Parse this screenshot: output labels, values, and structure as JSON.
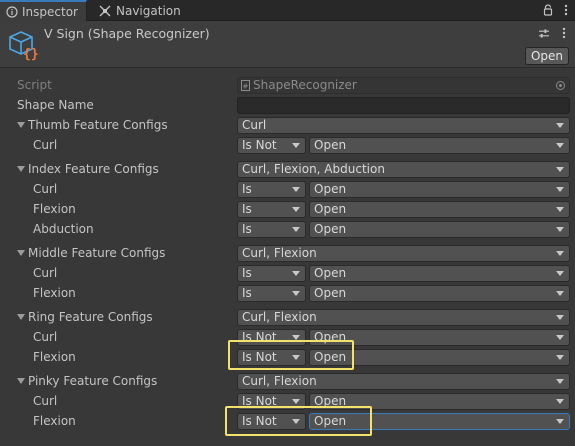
{
  "tabs": {
    "inspector": "Inspector",
    "navigation": "Navigation"
  },
  "header": {
    "title": "V Sign (Shape Recognizer)",
    "open_button": "Open"
  },
  "script_row": {
    "label": "Script",
    "value": "ShapeRecognizer"
  },
  "shape_name": {
    "label": "Shape Name",
    "value": ""
  },
  "groups": [
    {
      "label": "Thumb Feature Configs",
      "mask": "Curl",
      "rows": [
        {
          "feature": "Curl",
          "mode": "Is Not",
          "state": "Open"
        }
      ]
    },
    {
      "label": "Index Feature Configs",
      "mask": "Curl, Flexion, Abduction",
      "rows": [
        {
          "feature": "Curl",
          "mode": "Is",
          "state": "Open"
        },
        {
          "feature": "Flexion",
          "mode": "Is",
          "state": "Open"
        },
        {
          "feature": "Abduction",
          "mode": "Is",
          "state": "Open"
        }
      ]
    },
    {
      "label": "Middle Feature Configs",
      "mask": "Curl, Flexion",
      "rows": [
        {
          "feature": "Curl",
          "mode": "Is",
          "state": "Open"
        },
        {
          "feature": "Flexion",
          "mode": "Is",
          "state": "Open"
        }
      ]
    },
    {
      "label": "Ring Feature Configs",
      "mask": "Curl, Flexion",
      "rows": [
        {
          "feature": "Curl",
          "mode": "Is Not",
          "state": "Open"
        },
        {
          "feature": "Flexion",
          "mode": "Is Not",
          "state": "Open"
        }
      ]
    },
    {
      "label": "Pinky Feature Configs",
      "mask": "Curl, Flexion",
      "rows": [
        {
          "feature": "Curl",
          "mode": "Is Not",
          "state": "Open"
        },
        {
          "feature": "Flexion",
          "mode": "Is Not",
          "state": "Open"
        }
      ]
    }
  ],
  "colors": {
    "highlight": "#f2e16a",
    "accent": "#3a79bb",
    "panel": "#383838"
  },
  "icons": {
    "tab_inspector": "info-icon",
    "tab_navigation": "navigation-icon",
    "lock": "lock-icon",
    "more": "kebab-menu-icon",
    "object": "scriptable-object-icon",
    "settings": "preset-sliders-icon"
  }
}
